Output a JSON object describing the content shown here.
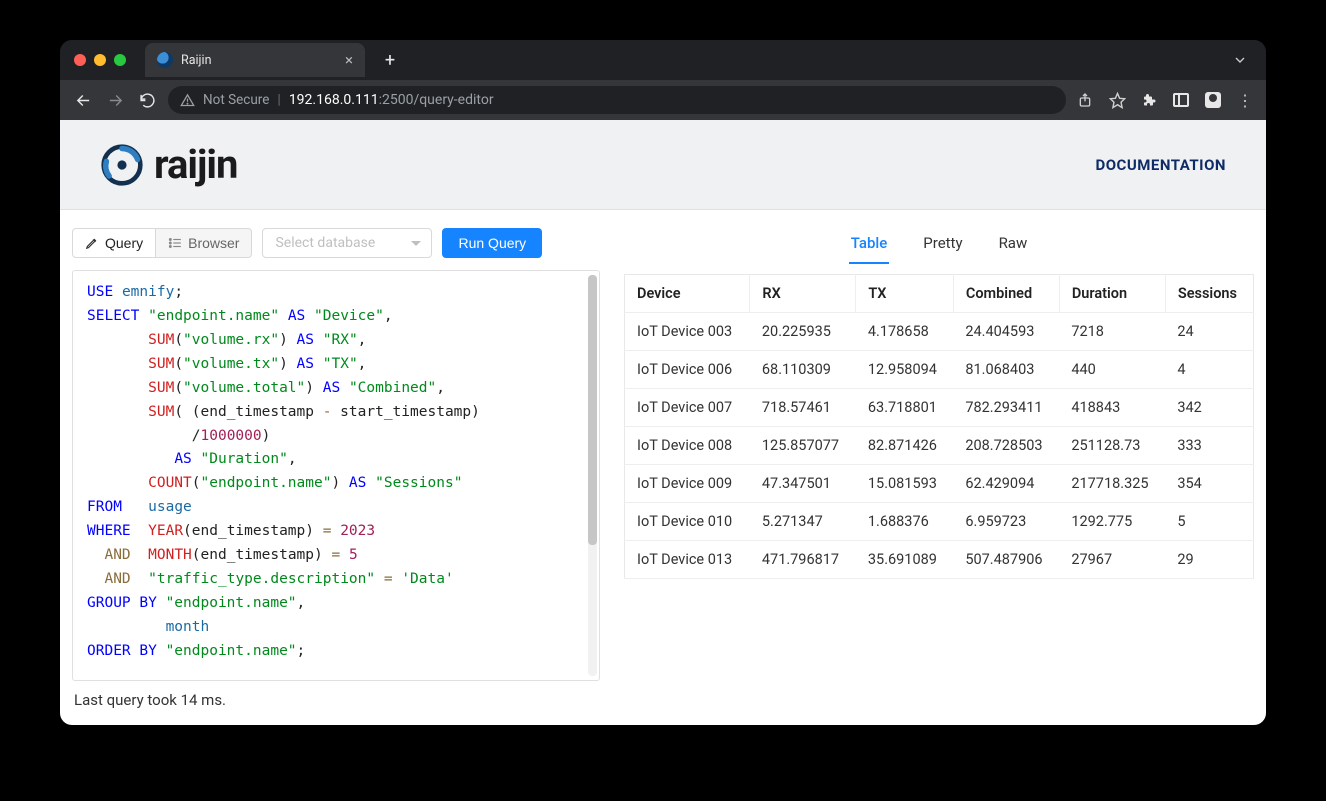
{
  "browser": {
    "tab_title": "Raijin",
    "url_host": "192.168.0.111",
    "url_port_path": ":2500/query-editor",
    "not_secure": "Not Secure"
  },
  "header": {
    "logo_text": "raijin",
    "documentation": "DOCUMENTATION"
  },
  "toolbar": {
    "query_btn": "Query",
    "browser_btn": "Browser",
    "db_placeholder": "Select database",
    "run_btn": "Run Query"
  },
  "status": {
    "text": "Last query took 14 ms."
  },
  "result_tabs": {
    "table": "Table",
    "pretty": "Pretty",
    "raw": "Raw"
  },
  "results": {
    "columns": [
      "Device",
      "RX",
      "TX",
      "Combined",
      "Duration",
      "Sessions"
    ],
    "rows": [
      [
        "IoT Device 003",
        "20.225935",
        "4.178658",
        "24.404593",
        "7218",
        "24"
      ],
      [
        "IoT Device 006",
        "68.110309",
        "12.958094",
        "81.068403",
        "440",
        "4"
      ],
      [
        "IoT Device 007",
        "718.57461",
        "63.718801",
        "782.293411",
        "418843",
        "342"
      ],
      [
        "IoT Device 008",
        "125.857077",
        "82.871426",
        "208.728503",
        "251128.73",
        "333"
      ],
      [
        "IoT Device 009",
        "47.347501",
        "15.081593",
        "62.429094",
        "217718.325",
        "354"
      ],
      [
        "IoT Device 010",
        "5.271347",
        "1.688376",
        "6.959723",
        "1292.775",
        "5"
      ],
      [
        "IoT Device 013",
        "471.796817",
        "35.691089",
        "507.487906",
        "27967",
        "29"
      ]
    ]
  },
  "query": {
    "lines": [
      [
        {
          "t": "USE",
          "c": "kw"
        },
        {
          "t": " "
        },
        {
          "t": "emnify",
          "c": "id"
        },
        {
          "t": ";"
        }
      ],
      [
        {
          "t": "SELECT",
          "c": "kw"
        },
        {
          "t": " "
        },
        {
          "t": "\"endpoint.name\"",
          "c": "str"
        },
        {
          "t": " "
        },
        {
          "t": "AS",
          "c": "kw"
        },
        {
          "t": " "
        },
        {
          "t": "\"Device\"",
          "c": "str"
        },
        {
          "t": ","
        }
      ],
      [
        {
          "t": "       "
        },
        {
          "t": "SUM",
          "c": "fn"
        },
        {
          "t": "("
        },
        {
          "t": "\"volume.rx\"",
          "c": "str"
        },
        {
          "t": ") "
        },
        {
          "t": "AS",
          "c": "kw"
        },
        {
          "t": " "
        },
        {
          "t": "\"RX\"",
          "c": "str"
        },
        {
          "t": ","
        }
      ],
      [
        {
          "t": "       "
        },
        {
          "t": "SUM",
          "c": "fn"
        },
        {
          "t": "("
        },
        {
          "t": "\"volume.tx\"",
          "c": "str"
        },
        {
          "t": ") "
        },
        {
          "t": "AS",
          "c": "kw"
        },
        {
          "t": " "
        },
        {
          "t": "\"TX\"",
          "c": "str"
        },
        {
          "t": ","
        }
      ],
      [
        {
          "t": "       "
        },
        {
          "t": "SUM",
          "c": "fn"
        },
        {
          "t": "("
        },
        {
          "t": "\"volume.total\"",
          "c": "str"
        },
        {
          "t": ") "
        },
        {
          "t": "AS",
          "c": "kw"
        },
        {
          "t": " "
        },
        {
          "t": "\"Combined\"",
          "c": "str"
        },
        {
          "t": ","
        }
      ],
      [
        {
          "t": "       "
        },
        {
          "t": "SUM",
          "c": "fn"
        },
        {
          "t": "( (end_timestamp "
        },
        {
          "t": "-",
          "c": "op"
        },
        {
          "t": " start_timestamp)"
        }
      ],
      [
        {
          "t": "            /"
        },
        {
          "t": "1000000",
          "c": "num"
        },
        {
          "t": ")"
        }
      ],
      [
        {
          "t": "          "
        },
        {
          "t": "AS",
          "c": "kw"
        },
        {
          "t": " "
        },
        {
          "t": "\"Duration\"",
          "c": "str"
        },
        {
          "t": ","
        }
      ],
      [
        {
          "t": "       "
        },
        {
          "t": "COUNT",
          "c": "fn"
        },
        {
          "t": "("
        },
        {
          "t": "\"endpoint.name\"",
          "c": "str"
        },
        {
          "t": ") "
        },
        {
          "t": "AS",
          "c": "kw"
        },
        {
          "t": " "
        },
        {
          "t": "\"Sessions\"",
          "c": "str"
        }
      ],
      [
        {
          "t": "FROM",
          "c": "kw"
        },
        {
          "t": "   "
        },
        {
          "t": "usage",
          "c": "id"
        }
      ],
      [
        {
          "t": "WHERE",
          "c": "kw"
        },
        {
          "t": "  "
        },
        {
          "t": "YEAR",
          "c": "fn"
        },
        {
          "t": "(end_timestamp) "
        },
        {
          "t": "=",
          "c": "op"
        },
        {
          "t": " "
        },
        {
          "t": "2023",
          "c": "num"
        }
      ],
      [
        {
          "t": "  "
        },
        {
          "t": "AND",
          "c": "op"
        },
        {
          "t": "  "
        },
        {
          "t": "MONTH",
          "c": "fn"
        },
        {
          "t": "(end_timestamp) "
        },
        {
          "t": "=",
          "c": "op"
        },
        {
          "t": " "
        },
        {
          "t": "5",
          "c": "num"
        }
      ],
      [
        {
          "t": "  "
        },
        {
          "t": "AND",
          "c": "op"
        },
        {
          "t": "  "
        },
        {
          "t": "\"traffic_type.description\"",
          "c": "str"
        },
        {
          "t": " "
        },
        {
          "t": "=",
          "c": "op"
        },
        {
          "t": " "
        },
        {
          "t": "'Data'",
          "c": "str"
        }
      ],
      [
        {
          "t": "GROUP BY",
          "c": "kw"
        },
        {
          "t": " "
        },
        {
          "t": "\"endpoint.name\"",
          "c": "str"
        },
        {
          "t": ","
        }
      ],
      [
        {
          "t": "         "
        },
        {
          "t": "month",
          "c": "id"
        }
      ],
      [
        {
          "t": "ORDER BY",
          "c": "kw"
        },
        {
          "t": " "
        },
        {
          "t": "\"endpoint.name\"",
          "c": "str"
        },
        {
          "t": ";"
        }
      ]
    ]
  }
}
